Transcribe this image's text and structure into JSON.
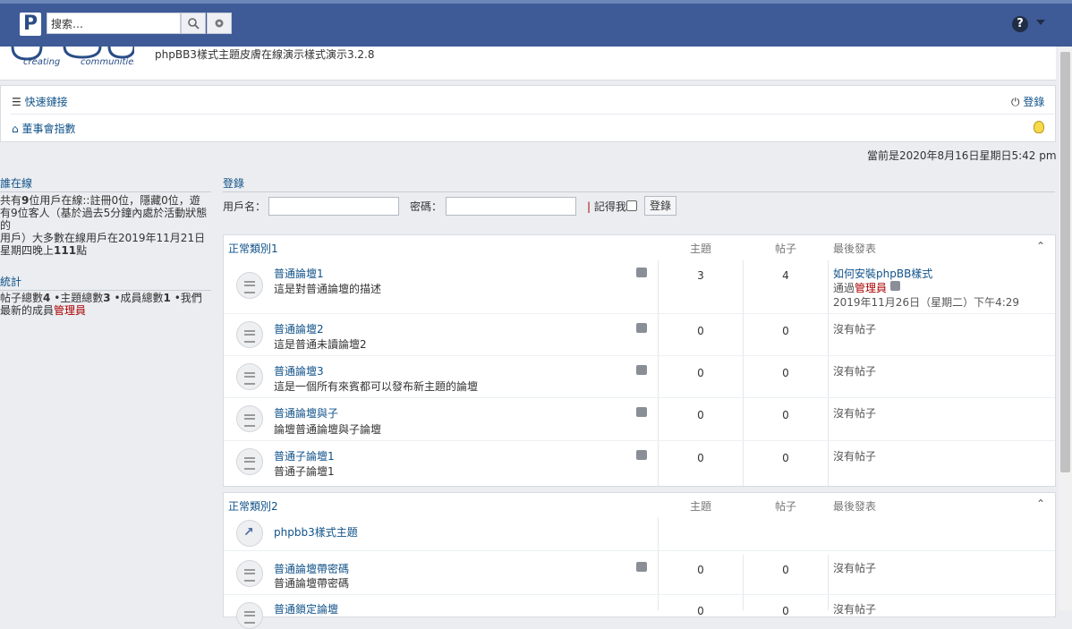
{
  "topbar": {
    "logo_letter": "P",
    "search_placeholder": "搜索…",
    "search_icon": "search-icon",
    "gear_icon": "gear-icon",
    "help_icon_glyph": "?",
    "caret_icon": "chevron-down-icon"
  },
  "header": {
    "logo_text": "phpBB creating communities",
    "description": "phpBB3樣式主題皮膚在線演示樣式演示3.2.8"
  },
  "nav": {
    "quick_links": "快速鏈接",
    "login": "登錄",
    "board_index": "董事會指數"
  },
  "current_time": "當前是2020年8月16日星期日5:42 pm",
  "sidebar": {
    "online_title": "誰在線",
    "online_text_1a": "共有",
    "online_count": "9",
    "online_text_1b": "位用戶在線::註冊0位，隱藏0位，遊",
    "online_text_2": "有9位客人（基於過去5分鐘內處於活動狀態",
    "online_text_3": "的",
    "online_text_4": "用戶）大多數在線用戶在2019年11月21日",
    "online_text_5a": "星期四晚上",
    "online_record": "111",
    "online_text_5b": "點",
    "stats_title": "統計",
    "stats_posts_label": "帖子總數",
    "stats_posts": "4",
    "stats_topics_label": " •主題總數",
    "stats_topics": "3",
    "stats_members_label": " •成員總數",
    "stats_members": "1",
    "stats_newest_label": " •我們",
    "stats_newest_label2": "最新的成員",
    "stats_newest_member": "管理員"
  },
  "login": {
    "title": "登錄",
    "username_label": "用戶名：",
    "password_label": "密碼：",
    "remember_label": "記得我",
    "button": "登錄"
  },
  "categories": [
    {
      "title": "正常類別1",
      "col_topics": "主題",
      "col_posts": "帖子",
      "col_last": "最後發表",
      "forums": [
        {
          "name": "普通論壇1",
          "desc": "這是對普通論壇的描述",
          "topics": "3",
          "posts": "4",
          "last_title": "如何安裝phpBB樣式",
          "last_by": "通過",
          "last_user": "管理員",
          "last_date": "2019年11月26日（星期二）下午4:29"
        },
        {
          "name": "普通論壇2",
          "desc": "這是普通未讀論壇2",
          "topics": "0",
          "posts": "0",
          "last": "沒有帖子"
        },
        {
          "name": "普通論壇3",
          "desc": "這是一個所有來賓都可以發布新主題的論壇",
          "topics": "0",
          "posts": "0",
          "last": "沒有帖子"
        },
        {
          "name": "普通論壇與子",
          "desc": "論壇普通論壇與子論壇",
          "topics": "0",
          "posts": "0",
          "last": "沒有帖子"
        },
        {
          "name": "普通子論壇1",
          "desc": "普通子論壇1",
          "topics": "0",
          "posts": "0",
          "last": "沒有帖子"
        }
      ]
    },
    {
      "title": "正常類別2",
      "col_topics": "主題",
      "col_posts": "帖子",
      "col_last": "最後發表",
      "forums": [
        {
          "name": "phpbb3樣式主題"
        },
        {
          "name": "普通論壇帶密碼",
          "desc": "普通論壇帶密碼",
          "topics": "0",
          "posts": "0",
          "last": "沒有帖子"
        },
        {
          "name": "普通鎖定論壇",
          "topics": "0",
          "posts": "0",
          "last": "沒有帖子"
        }
      ]
    }
  ]
}
